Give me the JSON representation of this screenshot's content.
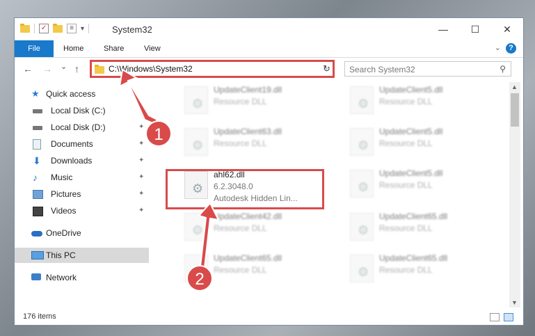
{
  "window": {
    "title": "System32",
    "controls": {
      "minimize": "—",
      "maximize": "☐",
      "close": "✕"
    }
  },
  "ribbon": {
    "tabs": [
      "File",
      "Home",
      "Share",
      "View"
    ],
    "help": "?"
  },
  "nav": {
    "back": "←",
    "forward": "→",
    "recent": "⌄",
    "up": "↑",
    "address": "C:\\Windows\\System32",
    "search_placeholder": "Search System32"
  },
  "sidebar": {
    "items": [
      {
        "label": "Quick access",
        "icon": "star-icon",
        "level": 0,
        "pinned": false
      },
      {
        "label": "Local Disk (C:)",
        "icon": "drive-icon",
        "level": 1,
        "pinned": true
      },
      {
        "label": "Local Disk (D:)",
        "icon": "drive-icon",
        "level": 1,
        "pinned": true
      },
      {
        "label": "Documents",
        "icon": "documents-icon",
        "level": 1,
        "pinned": true
      },
      {
        "label": "Downloads",
        "icon": "downloads-icon",
        "level": 1,
        "pinned": true
      },
      {
        "label": "Music",
        "icon": "music-icon",
        "level": 1,
        "pinned": true
      },
      {
        "label": "Pictures",
        "icon": "pictures-icon",
        "level": 1,
        "pinned": true
      },
      {
        "label": "Videos",
        "icon": "videos-icon",
        "level": 1,
        "pinned": true
      },
      {
        "label": "OneDrive",
        "icon": "cloud-icon",
        "level": 0,
        "pinned": false
      },
      {
        "label": "This PC",
        "icon": "computer-icon",
        "level": 0,
        "pinned": false,
        "selected": true
      },
      {
        "label": "Network",
        "icon": "network-icon",
        "level": 0,
        "pinned": false
      }
    ]
  },
  "files": {
    "left_column": [
      {
        "name": "UpdateClient19.dll",
        "desc": "Resource DLL"
      },
      {
        "name": "UpdateClient63.dll",
        "desc": "Resource DLL"
      },
      {
        "name": "ahl62.dll",
        "version": "6.2.3048.0",
        "desc": "Autodesk Hidden Lin..."
      },
      {
        "name": "UpdateClient42.dll",
        "desc": "Resource DLL"
      },
      {
        "name": "UpdateClient65.dll",
        "desc": "Resource DLL"
      }
    ],
    "right_column": [
      {
        "name": "UpdateClient5.dll",
        "desc": "Resource DLL"
      },
      {
        "name": "UpdateClient5.dll",
        "desc": "Resource DLL"
      },
      {
        "name": "UpdateClient5.dll",
        "desc": "Resource DLL"
      },
      {
        "name": "UpdateClient65.dll",
        "desc": "Resource DLL"
      },
      {
        "name": "UpdateClient65.dll",
        "desc": "Resource DLL"
      }
    ]
  },
  "status": {
    "items": "176 items"
  },
  "callouts": {
    "one": "1",
    "two": "2"
  },
  "colors": {
    "accent": "#1979ca",
    "highlight": "#d94a4a"
  }
}
